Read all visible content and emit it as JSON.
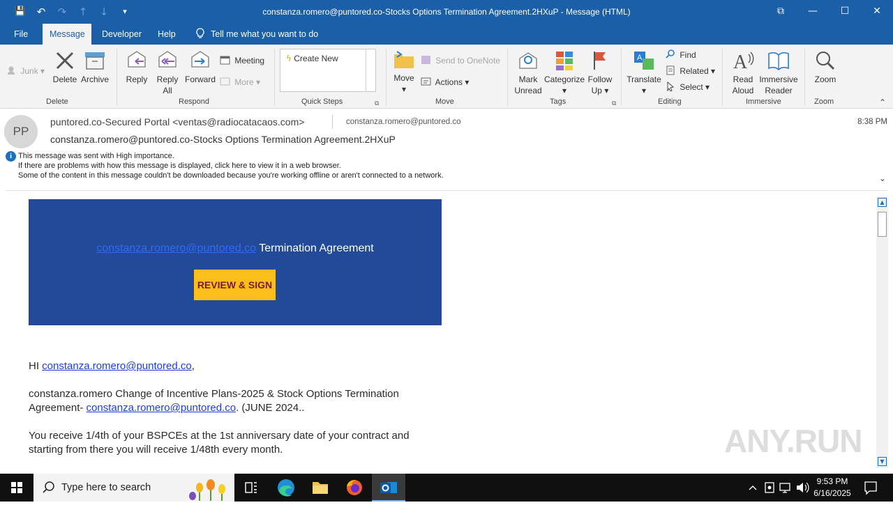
{
  "window": {
    "title": "constanza.romero@puntored.co-Stocks Options Termination Agreement.2HXuP  -  Message (HTML)",
    "controls": {
      "restore": "⧉",
      "minimize": "—",
      "maximize": "☐",
      "close": "✕"
    }
  },
  "qat": {
    "save": "💾",
    "undo": "↶",
    "redo": "↷",
    "up": "↑",
    "down": "↓",
    "customize": "▾"
  },
  "menu": {
    "file": "File",
    "message": "Message",
    "developer": "Developer",
    "help": "Help",
    "tell_me": "Tell me what you want to do"
  },
  "ribbon": {
    "delete_group": {
      "junk": "Junk",
      "delete": "Delete",
      "archive": "Archive",
      "label": "Delete"
    },
    "respond_group": {
      "reply": "Reply",
      "reply_all_1": "Reply",
      "reply_all_2": "All",
      "forward": "Forward",
      "meeting": "Meeting",
      "more": "More",
      "label": "Respond"
    },
    "quick_steps": {
      "create_new": "Create New",
      "label": "Quick Steps"
    },
    "move_group": {
      "move": "Move",
      "onenote": "Send to OneNote",
      "actions": "Actions",
      "label": "Move"
    },
    "tags_group": {
      "mark_1": "Mark",
      "mark_2": "Unread",
      "categorize": "Categorize",
      "follow_1": "Follow",
      "follow_2": "Up",
      "label": "Tags"
    },
    "editing_group": {
      "translate": "Translate",
      "find": "Find",
      "related": "Related",
      "select": "Select",
      "label": "Editing"
    },
    "immersive_group": {
      "read_1": "Read",
      "read_2": "Aloud",
      "reader_1": "Immersive",
      "reader_2": "Reader",
      "label": "Immersive"
    },
    "zoom_group": {
      "zoom": "Zoom",
      "label": "Zoom"
    }
  },
  "message": {
    "avatar_initials": "PP",
    "from": "puntored.co-Secured Portal <ventas@radiocatacaos.com>",
    "to": "constanza.romero@puntored.co",
    "time": "8:38 PM",
    "subject": "constanza.romero@puntored.co-Stocks Options Termination Agreement.2HXuP",
    "info": [
      "This message was sent with High importance.",
      "If there are problems with how this message is displayed, click here to view it in a web browser.",
      "Some of the content in this message couldn't be downloaded because you're working offline or aren't connected to a network."
    ]
  },
  "body": {
    "banner_link": "constanza.romero@puntored.co",
    "banner_text": " Termination Agreement",
    "sign_button": "REVIEW & SIGN",
    "greeting_prefix": "HI ",
    "greeting_link": "constanza.romero@puntored.co",
    "greeting_suffix": ",",
    "para1_text": "constanza.romero Change of Incentive Plans-2025 & Stock Options Termination Agreement- ",
    "para1_link": "constanza.romero@puntored.co",
    "para1_suffix": ". (JUNE 2024..",
    "para2": "You receive 1/4th of your BSPCEs at the 1st anniversary date of your contract and starting from there you will receive 1/48th every month."
  },
  "watermark": "ANY.RUN",
  "taskbar": {
    "search_placeholder": "Type here to search",
    "time": "9:53 PM",
    "date": "6/16/2025"
  }
}
